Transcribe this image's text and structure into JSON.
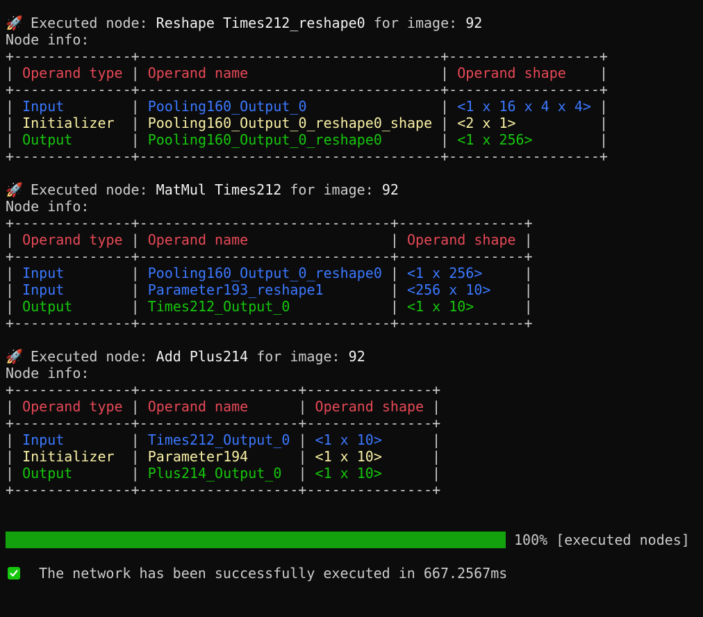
{
  "nodes": [
    {
      "prefix": "Executed node:",
      "op": "Reshape",
      "name": "Times212_reshape0",
      "for_label": "for image:",
      "image": "92",
      "info_label": "Node info:",
      "headers": [
        "Operand type",
        "Operand name",
        "Operand shape"
      ],
      "rows": [
        {
          "kind": "input",
          "type": "Input",
          "name": "Pooling160_Output_0",
          "shape": "<1 x 16 x 4 x 4>"
        },
        {
          "kind": "initializer",
          "type": "Initializer",
          "name": "Pooling160_Output_0_reshape0_shape",
          "shape": "<2 x 1>"
        },
        {
          "kind": "output",
          "type": "Output",
          "name": "Pooling160_Output_0_reshape0",
          "shape": "<1 x 256>"
        }
      ]
    },
    {
      "prefix": "Executed node:",
      "op": "MatMul",
      "name": "Times212",
      "for_label": "for image:",
      "image": "92",
      "info_label": "Node info:",
      "headers": [
        "Operand type",
        "Operand name",
        "Operand shape"
      ],
      "rows": [
        {
          "kind": "input",
          "type": "Input",
          "name": "Pooling160_Output_0_reshape0",
          "shape": "<1 x 256>"
        },
        {
          "kind": "input",
          "type": "Input",
          "name": "Parameter193_reshape1",
          "shape": "<256 x 10>"
        },
        {
          "kind": "output",
          "type": "Output",
          "name": "Times212_Output_0",
          "shape": "<1 x 10>"
        }
      ]
    },
    {
      "prefix": "Executed node:",
      "op": "Add",
      "name": "Plus214",
      "for_label": "for image:",
      "image": "92",
      "info_label": "Node info:",
      "headers": [
        "Operand type",
        "Operand name",
        "Operand shape"
      ],
      "rows": [
        {
          "kind": "input",
          "type": "Input",
          "name": "Times212_Output_0",
          "shape": "<1 x 10>"
        },
        {
          "kind": "initializer",
          "type": "Initializer",
          "name": "Parameter194",
          "shape": "<1 x 10>"
        },
        {
          "kind": "output",
          "type": "Output",
          "name": "Plus214_Output_0",
          "shape": "<1 x 10>"
        }
      ]
    }
  ],
  "progress": {
    "percent": 100,
    "label": "100% [executed nodes]"
  },
  "completion": {
    "icon": "check-box-icon",
    "message": "The network has been successfully executed in 667.2567ms"
  },
  "colors": {
    "background": "#0c0c0c",
    "text": "#cccccc",
    "header": "#e74856",
    "input": "#3b78ff",
    "initializer": "#f9f1a5",
    "output": "#16c60c",
    "progress_fill": "#13a10e"
  },
  "icons": {
    "node_icon": "rocket-icon"
  }
}
